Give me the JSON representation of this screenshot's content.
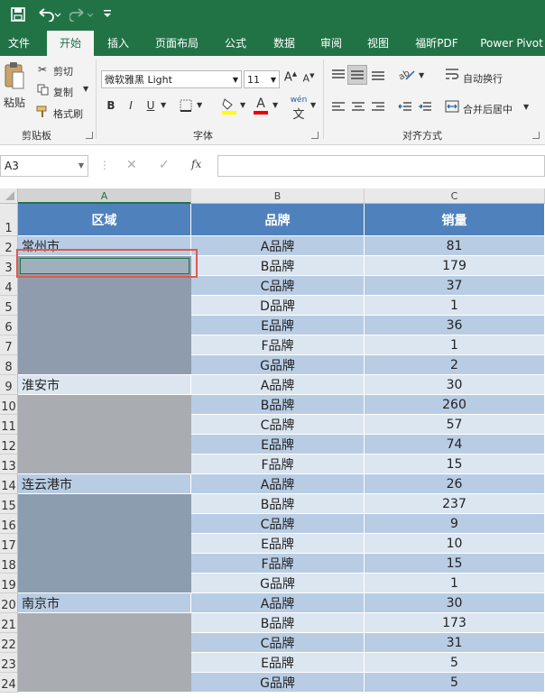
{
  "quick_access": {
    "save_icon": "save-icon",
    "undo_icon": "undo-icon",
    "redo_icon": "redo-icon",
    "customize_icon": "customize-icon"
  },
  "tabs": [
    "文件",
    "开始",
    "插入",
    "页面布局",
    "公式",
    "数据",
    "审阅",
    "视图",
    "福昕PDF",
    "Power Pivot"
  ],
  "active_tab": "开始",
  "ribbon": {
    "clipboard": {
      "paste": "粘贴",
      "cut": "剪切",
      "copy": "复制",
      "format_painter": "格式刷",
      "group": "剪贴板"
    },
    "font": {
      "name": "微软雅黑 Light",
      "size": "11",
      "group": "字体",
      "bold": "B",
      "italic": "I",
      "underline": "U",
      "font_color": "A",
      "phonetic": "wén"
    },
    "alignment": {
      "wrap_text": "自动换行",
      "merge_center": "合并后居中",
      "group": "对齐方式"
    }
  },
  "formula_bar": {
    "name_box": "A3",
    "fx": "fx",
    "value": ""
  },
  "columns": [
    "A",
    "B",
    "C"
  ],
  "header_row": {
    "region": "区域",
    "brand": "品牌",
    "sales": "销量"
  },
  "rows": [
    {
      "n": "2",
      "region": "常州市",
      "brand": "A品牌",
      "sales": "81"
    },
    {
      "n": "3",
      "region": "",
      "brand": "B品牌",
      "sales": "179"
    },
    {
      "n": "4",
      "region": "",
      "brand": "C品牌",
      "sales": "37"
    },
    {
      "n": "5",
      "region": "",
      "brand": "D品牌",
      "sales": "1"
    },
    {
      "n": "6",
      "region": "",
      "brand": "E品牌",
      "sales": "36"
    },
    {
      "n": "7",
      "region": "",
      "brand": "F品牌",
      "sales": "1"
    },
    {
      "n": "8",
      "region": "",
      "brand": "G品牌",
      "sales": "2"
    },
    {
      "n": "9",
      "region": "淮安市",
      "brand": "A品牌",
      "sales": "30"
    },
    {
      "n": "10",
      "region": "",
      "brand": "B品牌",
      "sales": "260"
    },
    {
      "n": "11",
      "region": "",
      "brand": "C品牌",
      "sales": "57"
    },
    {
      "n": "12",
      "region": "",
      "brand": "E品牌",
      "sales": "74"
    },
    {
      "n": "13",
      "region": "",
      "brand": "F品牌",
      "sales": "15"
    },
    {
      "n": "14",
      "region": "连云港市",
      "brand": "A品牌",
      "sales": "26"
    },
    {
      "n": "15",
      "region": "",
      "brand": "B品牌",
      "sales": "237"
    },
    {
      "n": "16",
      "region": "",
      "brand": "C品牌",
      "sales": "9"
    },
    {
      "n": "17",
      "region": "",
      "brand": "E品牌",
      "sales": "10"
    },
    {
      "n": "18",
      "region": "",
      "brand": "F品牌",
      "sales": "15"
    },
    {
      "n": "19",
      "region": "",
      "brand": "G品牌",
      "sales": "1"
    },
    {
      "n": "20",
      "region": "南京市",
      "brand": "A品牌",
      "sales": "30"
    },
    {
      "n": "21",
      "region": "",
      "brand": "B品牌",
      "sales": "173"
    },
    {
      "n": "22",
      "region": "",
      "brand": "C品牌",
      "sales": "31"
    },
    {
      "n": "23",
      "region": "",
      "brand": "E品牌",
      "sales": "5"
    },
    {
      "n": "24",
      "region": "",
      "brand": "G品牌",
      "sales": "5"
    }
  ],
  "row1_label": "1",
  "colors": {
    "excel_green": "#217346",
    "header_blue": "#4f81bd",
    "band_dark": "#b8cce4",
    "band_light": "#dce6f1",
    "selection_red": "#e05a4a"
  }
}
